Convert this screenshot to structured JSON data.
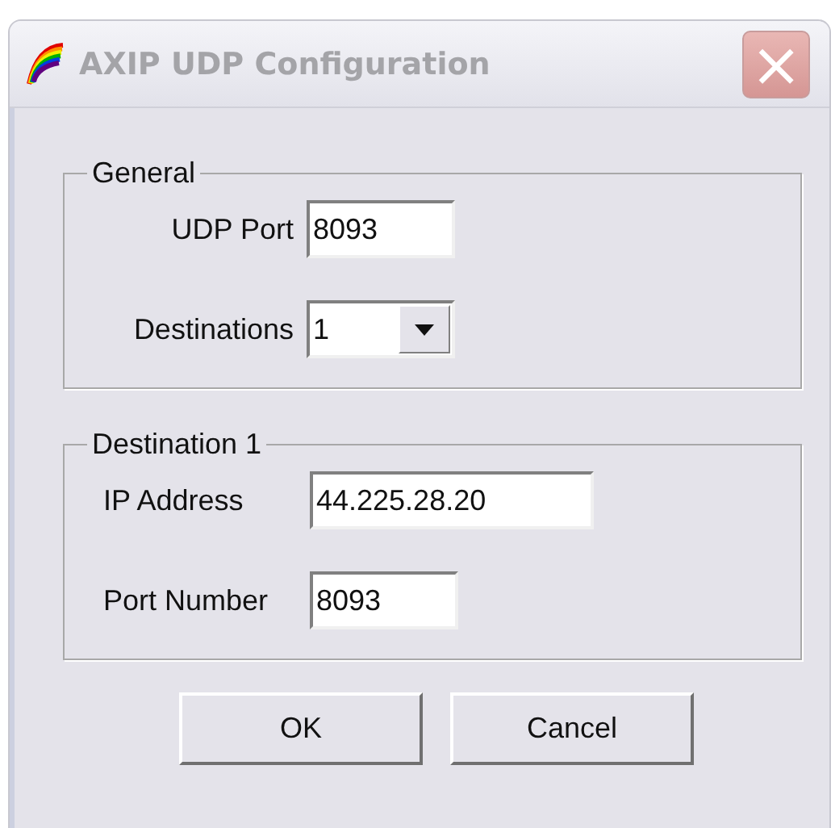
{
  "window": {
    "title": "AXIP UDP Configuration",
    "close": "×"
  },
  "groups": [
    {
      "title": "General",
      "fields": [
        {
          "label": "UDP Port",
          "value": "8093",
          "kind": "text"
        },
        {
          "label": "Destinations",
          "value": "1",
          "kind": "dropdown"
        }
      ]
    },
    {
      "title": "Destination 1",
      "fields": [
        {
          "label": "IP Address",
          "value": "44.225.28.20",
          "kind": "text",
          "wide": true
        },
        {
          "label": "Port Number",
          "value": "8093",
          "kind": "text"
        }
      ]
    }
  ],
  "buttons": [
    "OK",
    "Cancel"
  ]
}
